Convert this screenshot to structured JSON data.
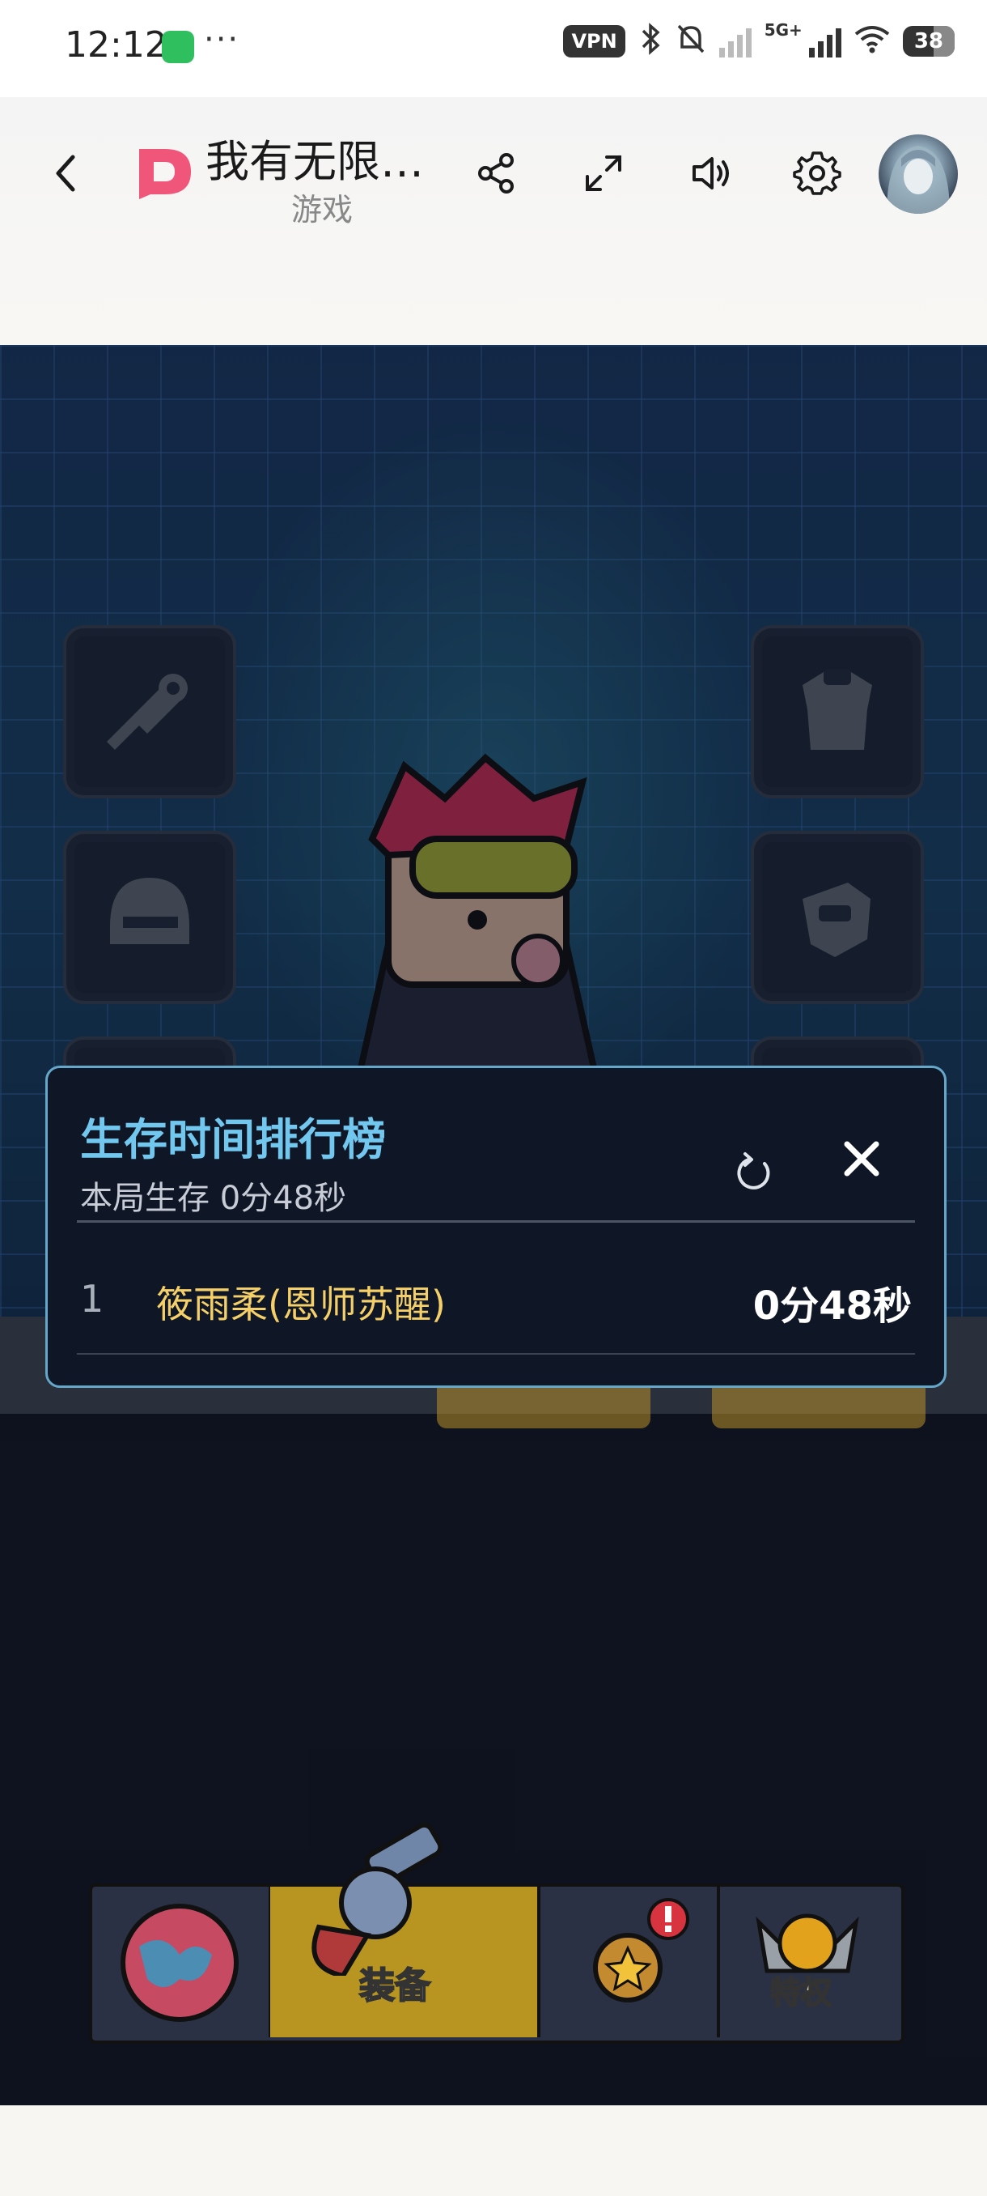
{
  "status_bar": {
    "time": "12:12",
    "dots": "···",
    "vpn": "VPN",
    "network": "5G+",
    "battery": "38"
  },
  "header": {
    "title": "我有无限…",
    "subtitle": "游戏"
  },
  "game": {
    "dock": {
      "equip_label": "装备",
      "privilege_label": "特权"
    }
  },
  "leaderboard": {
    "title": "生存时间排行榜",
    "current_survival": "本局生存 0分48秒",
    "rows": [
      {
        "rank": "1",
        "name": "筱雨柔(恩师苏醒)",
        "time": "0分48秒"
      }
    ]
  },
  "colors": {
    "accent": "#72c7ef",
    "name_highlight": "#f5cf68",
    "logo_pink": "#f0557a"
  }
}
